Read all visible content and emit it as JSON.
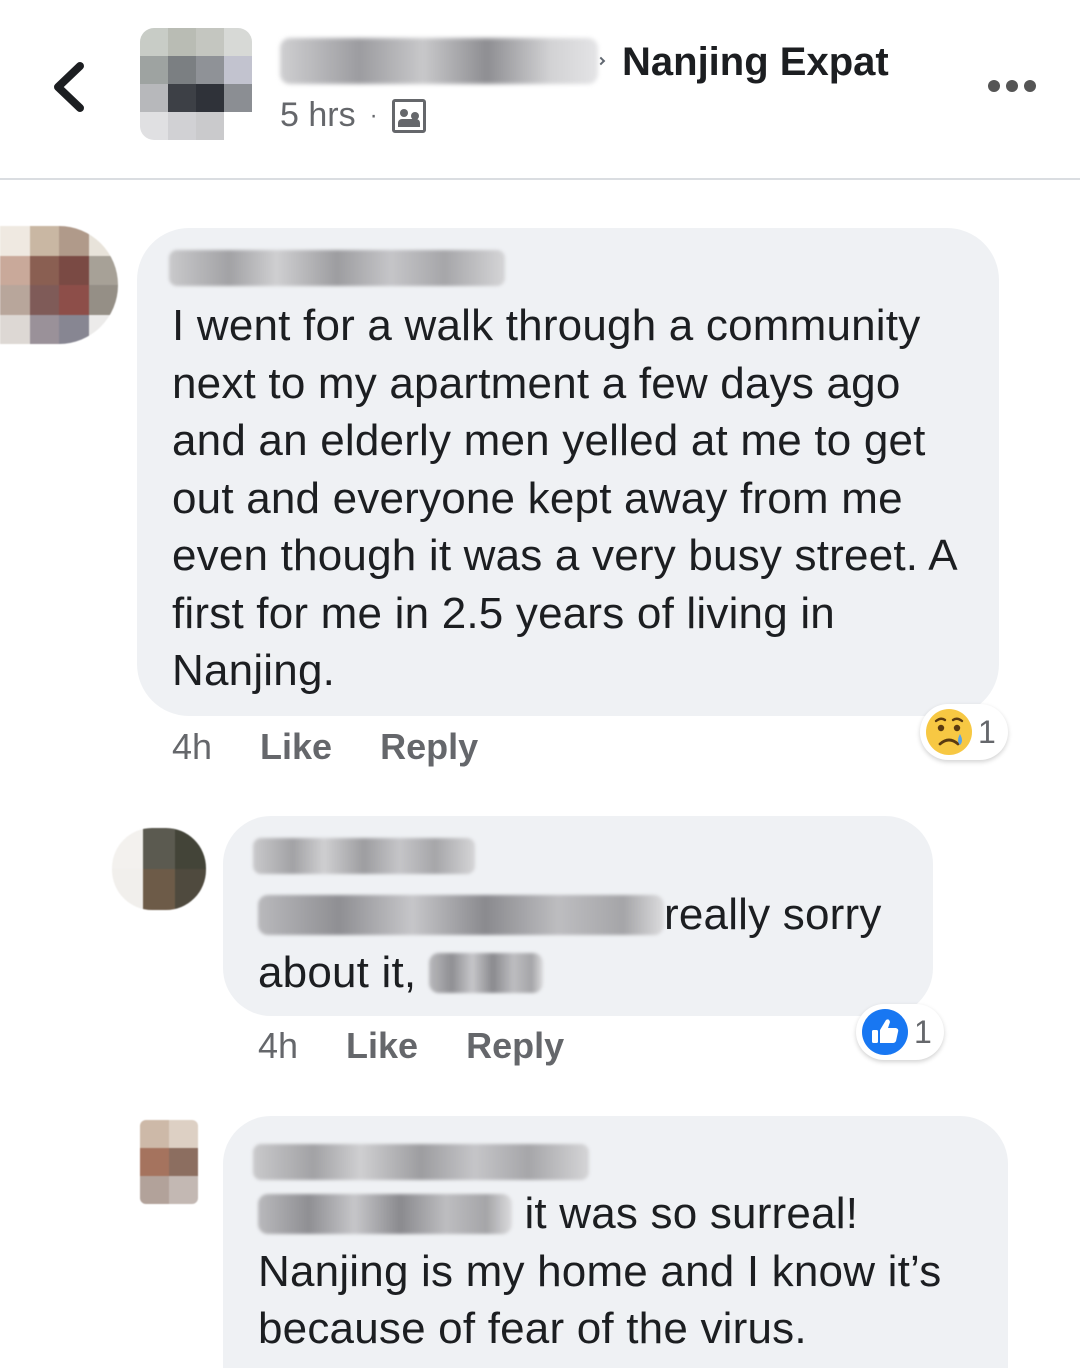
{
  "header": {
    "group_name": "Nanjing Expat",
    "time": "5 hrs",
    "separator": "·",
    "icons": {
      "back": "back-chevron-icon",
      "audience": "members-group-icon",
      "more": "more-options-icon"
    }
  },
  "comments": [
    {
      "text": "I went for a walk through a community next to my apartment a few days ago and an elderly men yelled at me to get out and everyone kept away from me even though it was a very busy street. A first for me in 2.5 years of living in Nanjing.",
      "time": "4h",
      "like_label": "Like",
      "reply_label": "Reply",
      "reaction": {
        "icon": "sad-face-reaction-icon",
        "count": "1"
      }
    },
    {
      "text_part1": "really sorry",
      "text_part2": "about it,",
      "time": "4h",
      "like_label": "Like",
      "reply_label": "Reply",
      "reaction": {
        "icon": "thumbs-up-reaction-icon",
        "count": "1"
      }
    },
    {
      "text_part1": "it was so surreal!",
      "text_part2": "Nanjing is my home and I know it’s because of fear of the virus."
    }
  ],
  "colors": {
    "bubble": "#eff1f4",
    "meta_text": "#65676b",
    "like_blue": "#1877f2"
  }
}
